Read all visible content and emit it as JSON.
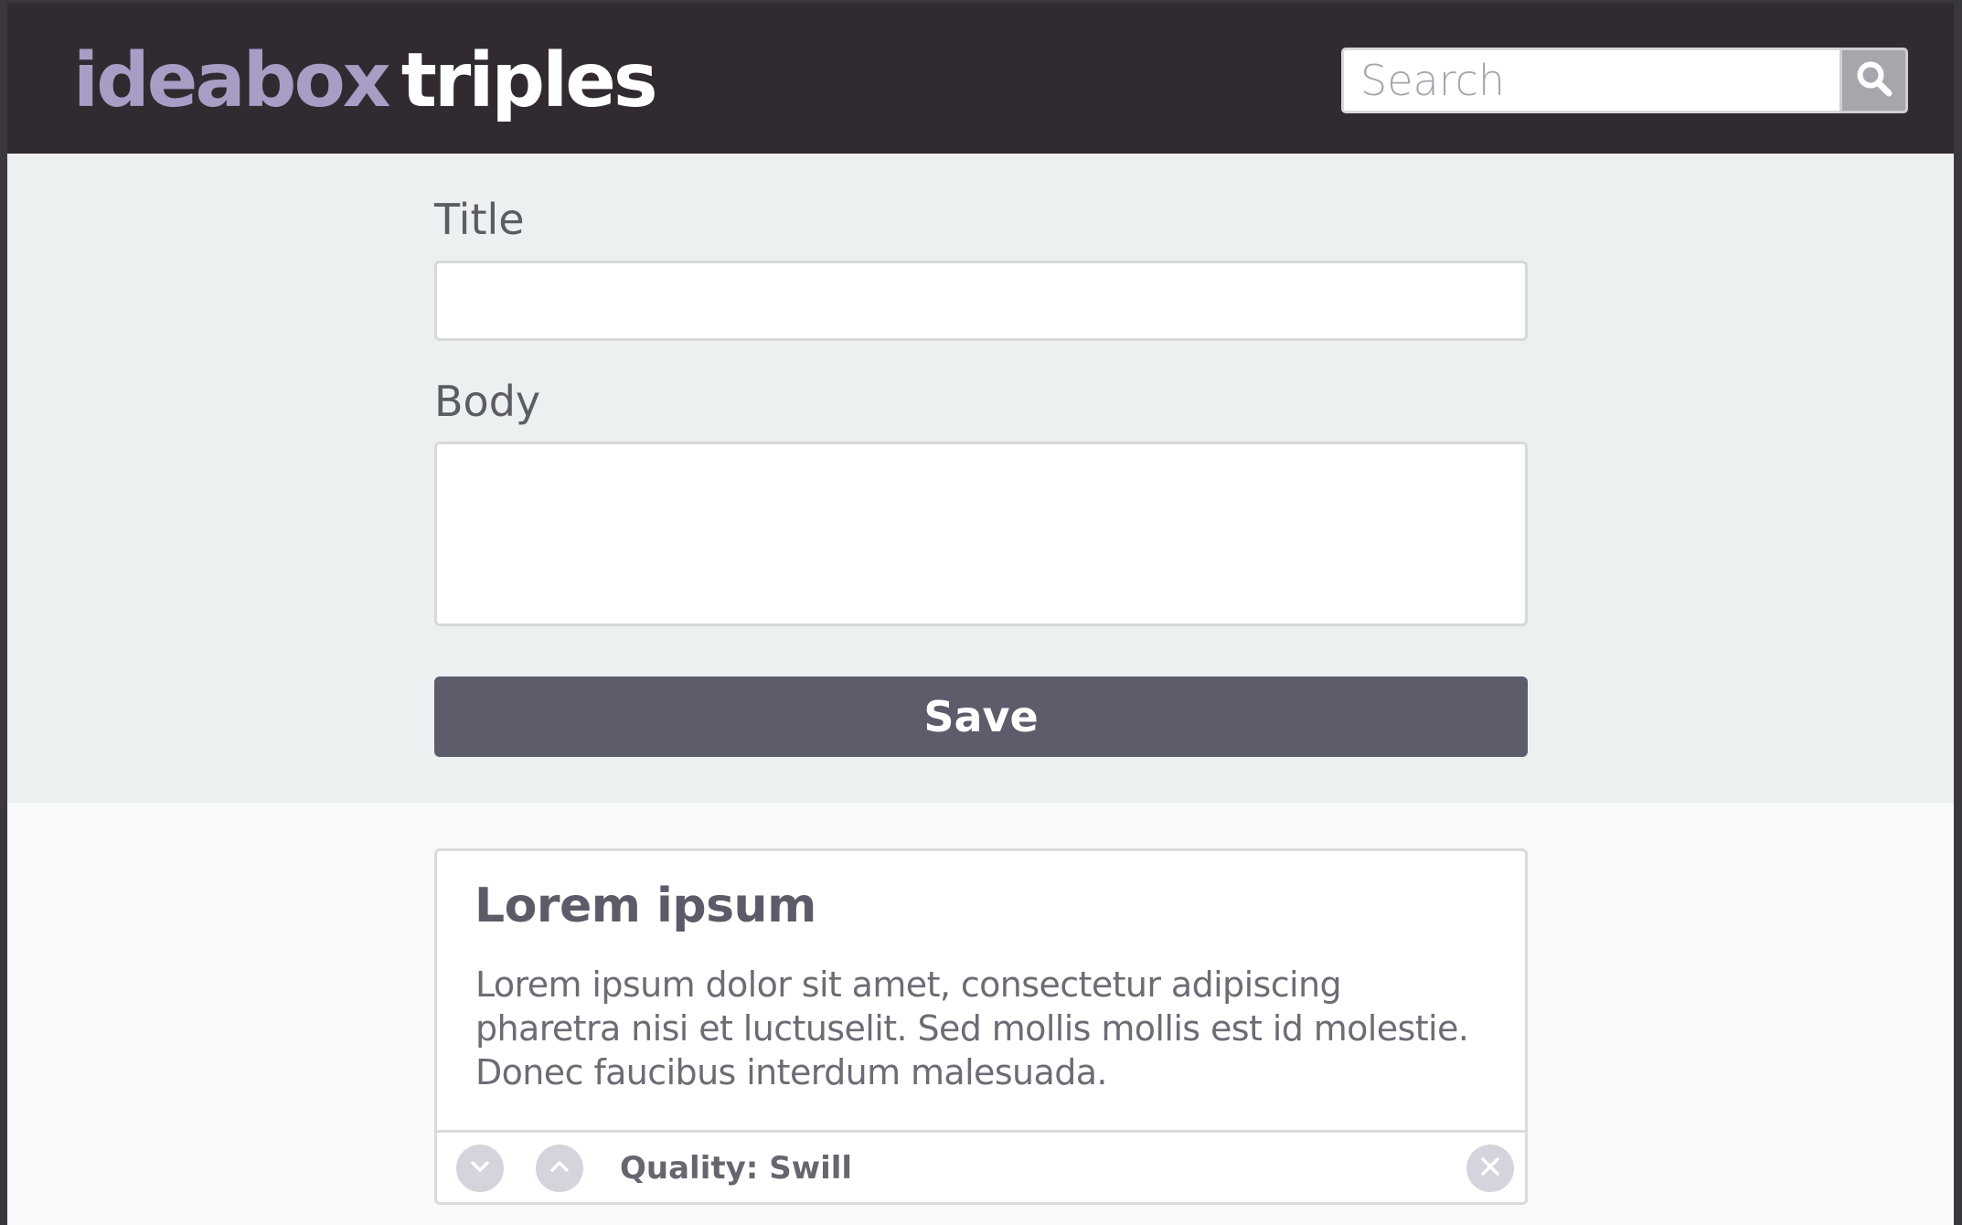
{
  "header": {
    "logo_part1": "ideabox",
    "logo_part2": "triples",
    "search_placeholder": "Search",
    "search_icon": "magnifier-icon"
  },
  "form": {
    "title_label": "Title",
    "title_value": "",
    "body_label": "Body",
    "body_value": "",
    "save_label": "Save"
  },
  "ideas": [
    {
      "title": "Lorem ipsum",
      "body": "Lorem ipsum dolor sit amet, consectetur adipiscing pharetra nisi et luctuselit. Sed mollis mollis est id molestie. Donec faucibus interdum malesuada.",
      "quality": "Quality: Swill",
      "downvote_icon": "chevron-down-icon",
      "upvote_icon": "chevron-up-icon",
      "delete_icon": "close-icon"
    }
  ],
  "colors": {
    "header_bg": "#312a30",
    "logo_accent": "#a79dc5",
    "button_bg": "#5d5c6b",
    "form_bg": "#edf0f0"
  }
}
